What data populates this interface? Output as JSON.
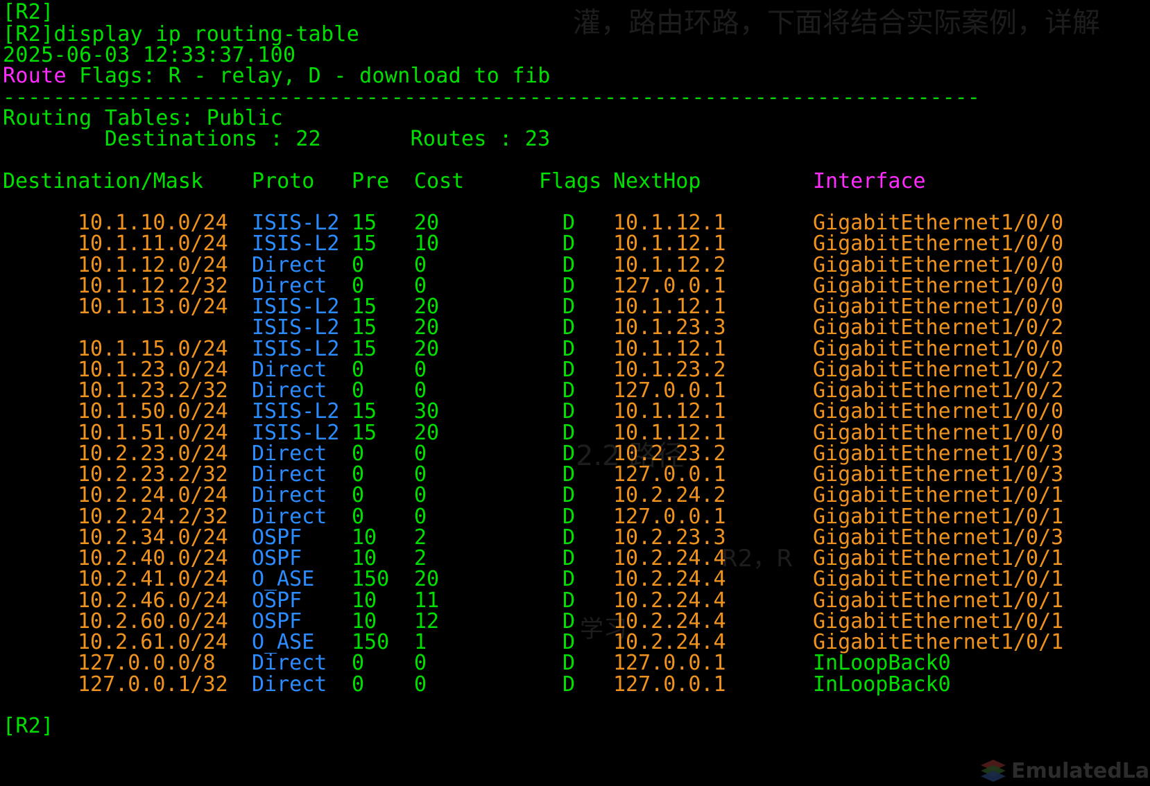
{
  "terminal": {
    "prompt_top": "[R2]",
    "command_line": "[R2]display ip routing-table",
    "timestamp": "2025-06-03 12:33:37.100",
    "flags_label": "Route",
    "flags_text": " Flags: R - relay, D - download to fib",
    "separator": "------------------------------------------------------------------------------",
    "routing_tables": "Routing Tables: Public",
    "summary": "        Destinations : 22       Routes : 23",
    "prompt_bottom": "[R2]"
  },
  "table": {
    "headers": {
      "destination": "Destination/Mask",
      "proto": "Proto",
      "pre": "Pre",
      "cost": "Cost",
      "flags": "Flags",
      "nexthop": "NextHop",
      "interface": "Interface"
    },
    "rows": [
      {
        "dest": "10.1.10.0/24",
        "proto": "ISIS-L2",
        "pre": "15",
        "cost": "20",
        "flags": "D",
        "nexthop": "10.1.12.1",
        "iface": "GigabitEthernet1/0/0"
      },
      {
        "dest": "10.1.11.0/24",
        "proto": "ISIS-L2",
        "pre": "15",
        "cost": "10",
        "flags": "D",
        "nexthop": "10.1.12.1",
        "iface": "GigabitEthernet1/0/0"
      },
      {
        "dest": "10.1.12.0/24",
        "proto": "Direct",
        "pre": "0",
        "cost": "0",
        "flags": "D",
        "nexthop": "10.1.12.2",
        "iface": "GigabitEthernet1/0/0"
      },
      {
        "dest": "10.1.12.2/32",
        "proto": "Direct",
        "pre": "0",
        "cost": "0",
        "flags": "D",
        "nexthop": "127.0.0.1",
        "iface": "GigabitEthernet1/0/0"
      },
      {
        "dest": "10.1.13.0/24",
        "proto": "ISIS-L2",
        "pre": "15",
        "cost": "20",
        "flags": "D",
        "nexthop": "10.1.12.1",
        "iface": "GigabitEthernet1/0/0"
      },
      {
        "dest": "",
        "proto": "ISIS-L2",
        "pre": "15",
        "cost": "20",
        "flags": "D",
        "nexthop": "10.1.23.3",
        "iface": "GigabitEthernet1/0/2"
      },
      {
        "dest": "10.1.15.0/24",
        "proto": "ISIS-L2",
        "pre": "15",
        "cost": "20",
        "flags": "D",
        "nexthop": "10.1.12.1",
        "iface": "GigabitEthernet1/0/0"
      },
      {
        "dest": "10.1.23.0/24",
        "proto": "Direct",
        "pre": "0",
        "cost": "0",
        "flags": "D",
        "nexthop": "10.1.23.2",
        "iface": "GigabitEthernet1/0/2"
      },
      {
        "dest": "10.1.23.2/32",
        "proto": "Direct",
        "pre": "0",
        "cost": "0",
        "flags": "D",
        "nexthop": "127.0.0.1",
        "iface": "GigabitEthernet1/0/2"
      },
      {
        "dest": "10.1.50.0/24",
        "proto": "ISIS-L2",
        "pre": "15",
        "cost": "30",
        "flags": "D",
        "nexthop": "10.1.12.1",
        "iface": "GigabitEthernet1/0/0"
      },
      {
        "dest": "10.1.51.0/24",
        "proto": "ISIS-L2",
        "pre": "15",
        "cost": "20",
        "flags": "D",
        "nexthop": "10.1.12.1",
        "iface": "GigabitEthernet1/0/0"
      },
      {
        "dest": "10.2.23.0/24",
        "proto": "Direct",
        "pre": "0",
        "cost": "0",
        "flags": "D",
        "nexthop": "10.2.23.2",
        "iface": "GigabitEthernet1/0/3"
      },
      {
        "dest": "10.2.23.2/32",
        "proto": "Direct",
        "pre": "0",
        "cost": "0",
        "flags": "D",
        "nexthop": "127.0.0.1",
        "iface": "GigabitEthernet1/0/3"
      },
      {
        "dest": "10.2.24.0/24",
        "proto": "Direct",
        "pre": "0",
        "cost": "0",
        "flags": "D",
        "nexthop": "10.2.24.2",
        "iface": "GigabitEthernet1/0/1"
      },
      {
        "dest": "10.2.24.2/32",
        "proto": "Direct",
        "pre": "0",
        "cost": "0",
        "flags": "D",
        "nexthop": "127.0.0.1",
        "iface": "GigabitEthernet1/0/1"
      },
      {
        "dest": "10.2.34.0/24",
        "proto": "OSPF",
        "pre": "10",
        "cost": "2",
        "flags": "D",
        "nexthop": "10.2.23.3",
        "iface": "GigabitEthernet1/0/3"
      },
      {
        "dest": "10.2.40.0/24",
        "proto": "OSPF",
        "pre": "10",
        "cost": "2",
        "flags": "D",
        "nexthop": "10.2.24.4",
        "iface": "GigabitEthernet1/0/1"
      },
      {
        "dest": "10.2.41.0/24",
        "proto": "O_ASE",
        "pre": "150",
        "cost": "20",
        "flags": "D",
        "nexthop": "10.2.24.4",
        "iface": "GigabitEthernet1/0/1"
      },
      {
        "dest": "10.2.46.0/24",
        "proto": "OSPF",
        "pre": "10",
        "cost": "11",
        "flags": "D",
        "nexthop": "10.2.24.4",
        "iface": "GigabitEthernet1/0/1"
      },
      {
        "dest": "10.2.60.0/24",
        "proto": "OSPF",
        "pre": "10",
        "cost": "12",
        "flags": "D",
        "nexthop": "10.2.24.4",
        "iface": "GigabitEthernet1/0/1"
      },
      {
        "dest": "10.2.61.0/24",
        "proto": "O_ASE",
        "pre": "150",
        "cost": "1",
        "flags": "D",
        "nexthop": "10.2.24.4",
        "iface": "GigabitEthernet1/0/1"
      },
      {
        "dest": "127.0.0.0/8",
        "proto": "Direct",
        "pre": "0",
        "cost": "0",
        "flags": "D",
        "nexthop": "127.0.0.1",
        "iface": "InLoopBack0"
      },
      {
        "dest": "127.0.0.1/32",
        "proto": "Direct",
        "pre": "0",
        "cost": "0",
        "flags": "D",
        "nexthop": "127.0.0.1",
        "iface": "InLoopBack0"
      }
    ]
  },
  "watermarks": {
    "top_right": "灌，路由环路，下面将结合实际案例，详解",
    "mid": "2.2 路径",
    "mid2": "R2，R",
    "mid3": "学习"
  },
  "logo": {
    "text": "EmulatedLab"
  },
  "colors": {
    "background": "#000000",
    "green": "#00e000",
    "magenta": "#ff2bff",
    "orange": "#f0931e",
    "blue": "#2b8cff"
  }
}
